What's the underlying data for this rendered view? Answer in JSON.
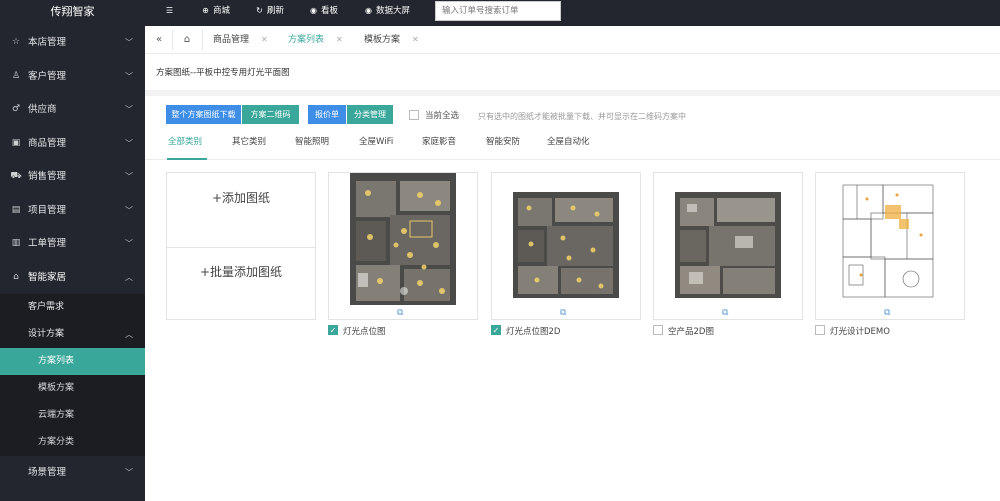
{
  "brand": "传翔智家",
  "sidebar": {
    "items": [
      {
        "label": "本店管理",
        "icon": "home-icon"
      },
      {
        "label": "客户管理",
        "icon": "user-icon"
      },
      {
        "label": "供应商",
        "icon": "male-icon"
      },
      {
        "label": "商品管理",
        "icon": "box-icon"
      },
      {
        "label": "销售管理",
        "icon": "cart-icon"
      },
      {
        "label": "项目管理",
        "icon": "project-icon"
      },
      {
        "label": "工单管理",
        "icon": "order-icon"
      },
      {
        "label": "智能家居",
        "icon": "smarthome-icon"
      }
    ],
    "sub": {
      "customer_demand": "客户需求",
      "design_plan": "设计方案",
      "plan_list": "方案列表",
      "template_plan": "模板方案",
      "cloud_plan": "云端方案",
      "plan_category": "方案分类",
      "scene_manage": "场景管理"
    }
  },
  "topbar": {
    "mall": "商城",
    "refresh": "刷新",
    "dashboard": "看板",
    "bigscreen": "数据大屏",
    "search_placeholder": "输入订单号搜索订单"
  },
  "tabs": [
    {
      "label": "商品管理"
    },
    {
      "label": "方案列表"
    },
    {
      "label": "模板方案"
    }
  ],
  "page": {
    "title": "方案图纸--平板中控专用灯光平面图",
    "btn_download": "整个方案图纸下载",
    "btn_qrcode": "方案二维码",
    "btn_quote": "报价单",
    "btn_category": "分类管理",
    "select_all": "当前全选",
    "hint": "只有选中的图纸才能被批量下载、并可显示在二维码方案中",
    "categories": [
      "全部类别",
      "其它类别",
      "智能照明",
      "全屋WiFi",
      "家庭影音",
      "智能安防",
      "全屋自动化"
    ],
    "add_drawing": "+添加图纸",
    "batch_add": "+批量添加图纸"
  },
  "cards": [
    {
      "label": "灯光点位图",
      "checked": true
    },
    {
      "label": "灯光点位图2D",
      "checked": true
    },
    {
      "label": "空产品2D图",
      "checked": false
    },
    {
      "label": "灯光设计DEMO",
      "checked": false
    }
  ],
  "colors": {
    "accent": "#3aa79b",
    "blue": "#3e8ee8",
    "dark": "#23262e"
  }
}
